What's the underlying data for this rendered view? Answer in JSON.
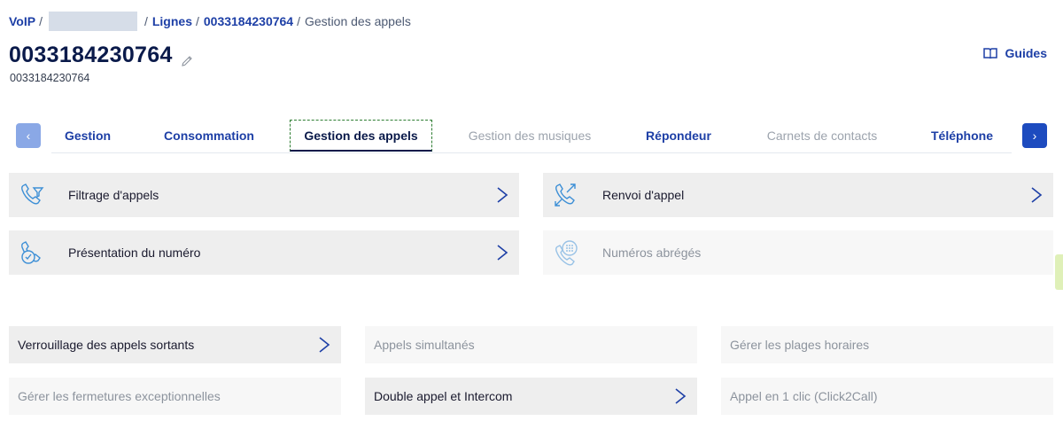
{
  "breadcrumb": {
    "voip": "VoIP",
    "sep1": "/",
    "sep2": "/",
    "lignes": "Lignes",
    "sep3": "/",
    "number": "0033184230764",
    "sep4": "/",
    "current": "Gestion des appels"
  },
  "header": {
    "title": "0033184230764",
    "subtitle": "0033184230764",
    "guides_label": "Guides"
  },
  "tabs": [
    {
      "label": "Gestion",
      "state": "enabled"
    },
    {
      "label": "Consommation",
      "state": "enabled"
    },
    {
      "label": "Gestion des appels",
      "state": "active"
    },
    {
      "label": "Gestion des musiques",
      "state": "disabled"
    },
    {
      "label": "Répondeur",
      "state": "enabled"
    },
    {
      "label": "Carnets de contacts",
      "state": "disabled"
    },
    {
      "label": "Téléphone",
      "state": "enabled"
    }
  ],
  "tab_nav": {
    "prev": "‹",
    "next": "›"
  },
  "features_large": [
    {
      "label": "Filtrage d'appels",
      "icon": "call-filter-icon",
      "enabled": true
    },
    {
      "label": "Renvoi d'appel",
      "icon": "call-forward-icon",
      "enabled": true
    },
    {
      "label": "Présentation du numéro",
      "icon": "number-display-icon",
      "enabled": true
    },
    {
      "label": "Numéros abrégés",
      "icon": "speed-dial-icon",
      "enabled": false
    }
  ],
  "features_small": [
    {
      "label": "Verrouillage des appels sortants",
      "enabled": true
    },
    {
      "label": "Appels simultanés",
      "enabled": false
    },
    {
      "label": "Gérer les plages horaires",
      "enabled": false
    },
    {
      "label": "Gérer les fermetures exceptionnelles",
      "enabled": false
    },
    {
      "label": "Double appel et Intercom",
      "enabled": true
    },
    {
      "label": "Appel en 1 clic (Click2Call)",
      "enabled": false
    }
  ],
  "colors": {
    "link": "#1d3fa6",
    "title": "#0a1a4a",
    "tile_bg": "#eeeeee",
    "tile_disabled_bg": "#f7f7f7",
    "icon_blue": "#3d8fd6",
    "chevron": "#1d3fa6"
  }
}
